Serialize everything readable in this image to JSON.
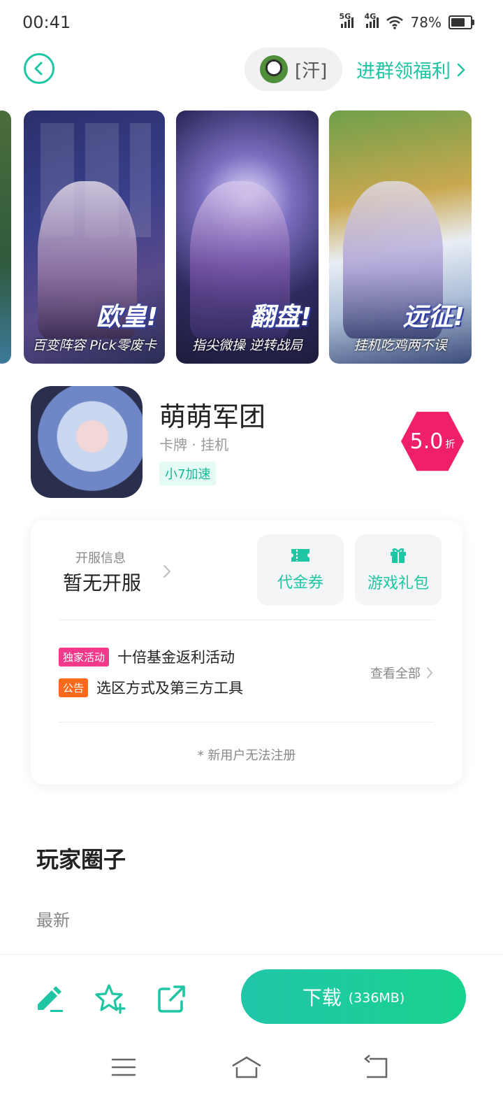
{
  "status_bar": {
    "time": "00:41",
    "network_1": "5G",
    "network_2": "4G",
    "battery": "78%",
    "battery_level": 0.78
  },
  "top_nav": {
    "back_icon": "chevron-left-icon",
    "group_emoji": "[汗]",
    "join_group": "进群领福利"
  },
  "screenshots": [
    {
      "headline": "欧皇!",
      "caption": "百变阵容 Pick零废卡"
    },
    {
      "headline": "翻盘!",
      "caption": "指尖微操 逆转战局"
    },
    {
      "headline": "远征!",
      "caption": "挂机吃鸡两不误"
    }
  ],
  "app": {
    "name": "萌萌军团",
    "meta": "卡牌 · 挂机",
    "speed_tag": "小7加速",
    "discount": "5.0",
    "discount_unit": "折"
  },
  "server_info": {
    "label": "开服信息",
    "value": "暂无开服"
  },
  "actions": {
    "voucher": "代金券",
    "gift": "游戏礼包"
  },
  "notices": [
    {
      "badge": "独家活动",
      "badge_color": "#f33a8a",
      "text": "十倍基金返利活动"
    },
    {
      "badge": "公告",
      "badge_color": "#ff6a1a",
      "text": "选区方式及第三方工具"
    }
  ],
  "view_all": "查看全部",
  "card_note": "* 新用户无法注册",
  "community": {
    "title": "玩家圈子",
    "tab_latest": "最新"
  },
  "bottom_bar": {
    "download_label": "下载",
    "download_size": "(336MB)"
  },
  "colors": {
    "accent": "#1ec6a4",
    "discount": "#f01f6a"
  }
}
